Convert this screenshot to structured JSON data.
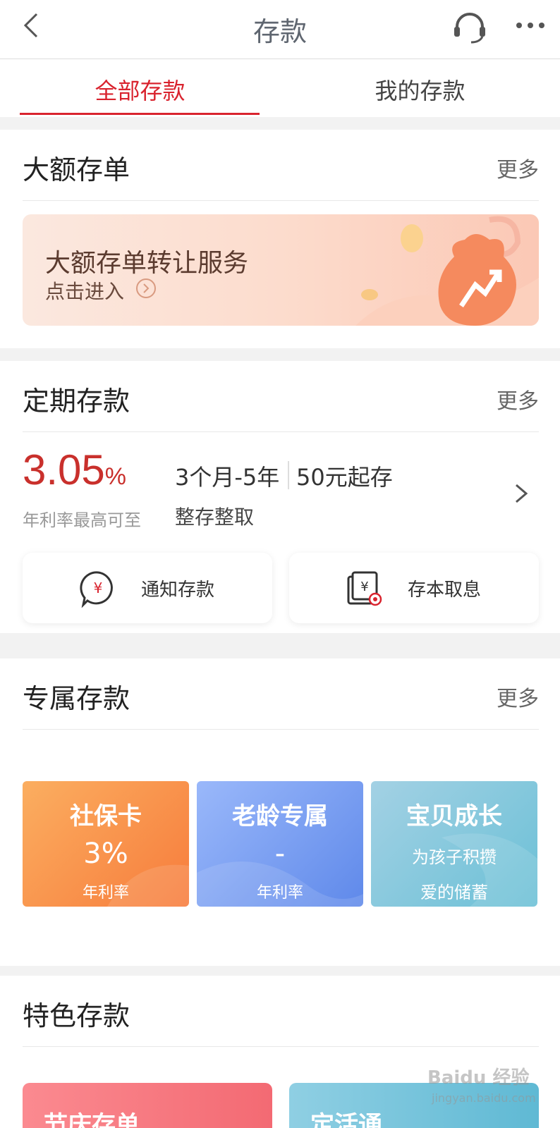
{
  "header": {
    "title": "存款"
  },
  "tabs": [
    {
      "label": "全部存款"
    },
    {
      "label": "我的存款"
    }
  ],
  "large_cd": {
    "title": "大额存单",
    "more": "更多",
    "banner_title": "大额存单转让服务",
    "banner_sub": "点击进入"
  },
  "fixed": {
    "title": "定期存款",
    "more": "更多",
    "rate": "3.05",
    "rate_unit": "%",
    "rate_label": "年利率最高可至",
    "term": "3个月-5年",
    "min_amount": "50元起存",
    "product": "整存整取",
    "sub_products": [
      {
        "label": "通知存款"
      },
      {
        "label": "存本取息"
      }
    ]
  },
  "exclusive": {
    "title": "专属存款",
    "more": "更多",
    "cards": [
      {
        "title": "社保卡",
        "value": "3%",
        "sub": "年利率"
      },
      {
        "title": "老龄专属",
        "value": "-",
        "sub": "年利率"
      },
      {
        "title": "宝贝成长",
        "line1": "为孩子积攒",
        "line2": "爱的储蓄"
      }
    ]
  },
  "featured": {
    "title": "特色存款",
    "cards": [
      {
        "title": "节庆存单"
      },
      {
        "title": "定活通"
      }
    ]
  },
  "watermark": {
    "main": "Baidu 经验",
    "sub": "jingyan.baidu.com"
  },
  "colors": {
    "accent": "#d9232e",
    "rate": "#c9302c"
  }
}
